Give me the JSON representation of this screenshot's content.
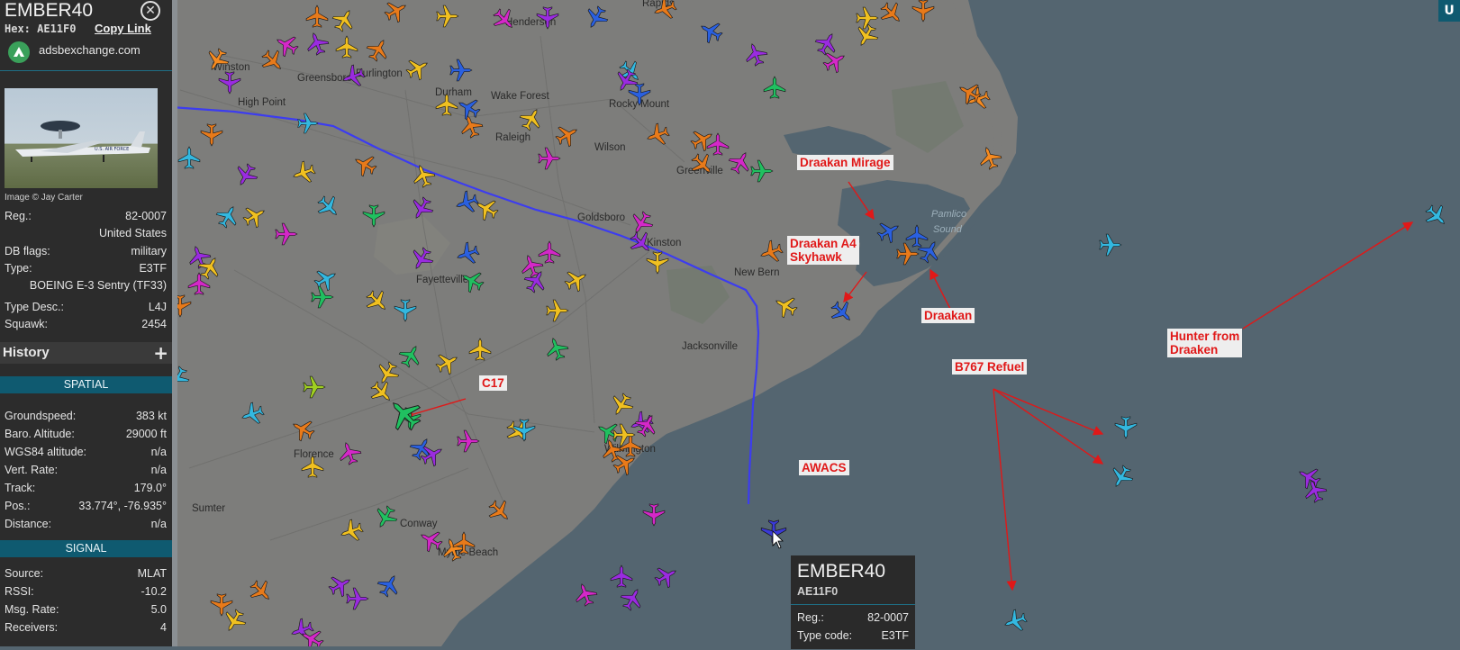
{
  "aircraft": {
    "callsign": "EMBER40",
    "hex_label": "Hex: AE11F0",
    "copy_link": "Copy Link",
    "source_site": "adsbexchange.com",
    "photo_credit": "Image © Jay Carter",
    "photo_livery": "U.S. AIR FORCE",
    "details": [
      {
        "key": "Reg.:",
        "value": "82-0007"
      },
      {
        "key": "",
        "value": "United States"
      },
      {
        "key": "DB flags:",
        "value": "military"
      },
      {
        "key": "Type:",
        "value": "E3TF"
      },
      {
        "key": "",
        "value": "BOEING E-3 Sentry (TF33)"
      },
      {
        "key": "Type Desc.:",
        "value": "L4J"
      },
      {
        "key": "Squawk:",
        "value": "2454"
      }
    ]
  },
  "history": {
    "title": "History",
    "add_icon": "plus-icon"
  },
  "spatial": {
    "title": "SPATIAL",
    "rows": [
      {
        "key": "Groundspeed:",
        "value": "383 kt"
      },
      {
        "key": "Baro. Altitude:",
        "value": "29000 ft"
      },
      {
        "key": "WGS84 altitude:",
        "value": "n/a"
      },
      {
        "key": "Vert. Rate:",
        "value": "n/a"
      },
      {
        "key": "Track:",
        "value": "179.0°"
      },
      {
        "key": "Pos.:",
        "value": "33.774°, -76.935°"
      },
      {
        "key": "Distance:",
        "value": "n/a"
      }
    ]
  },
  "signal": {
    "title": "SIGNAL",
    "rows": [
      {
        "key": "Source:",
        "value": "MLAT"
      },
      {
        "key": "RSSI:",
        "value": "-10.2"
      },
      {
        "key": "Msg. Rate:",
        "value": "5.0"
      },
      {
        "key": "Receivers:",
        "value": "4"
      }
    ]
  },
  "map": {
    "corner_button": "U",
    "places": [
      "Winston",
      "Greensboro",
      "Burlington",
      "Durham",
      "Wake Forest",
      "Raleigh",
      "Rocky Mount",
      "Wilson",
      "Greenville",
      "Goldsboro",
      "Kinston",
      "New Bern",
      "Jacksonville",
      "Fayetteville",
      "High Point",
      "Florence",
      "Wilmington",
      "Conway",
      "Myrtle Beach",
      "Sumter",
      "Pamlico",
      "Sound",
      "Rapids",
      "Henderson"
    ],
    "annotations": [
      {
        "id": "draakan-mirage",
        "text": "Draakan Mirage"
      },
      {
        "id": "draakan-a4",
        "text": "Draakan A4\nSkyhawk"
      },
      {
        "id": "draakan",
        "text": "Draakan"
      },
      {
        "id": "hunter",
        "text": "Hunter from\nDraaken"
      },
      {
        "id": "b767",
        "text": "B767 Refuel"
      },
      {
        "id": "c17",
        "text": "C17"
      },
      {
        "id": "awacs",
        "text": "AWACS"
      }
    ],
    "colors": {
      "water": "#546570",
      "land": "#7d7d7b",
      "track": "#3c3cf0",
      "arrow": "#e01818",
      "selected": "#3a3ad8"
    }
  },
  "tooltip": {
    "callsign": "EMBER40",
    "hex": "AE11F0",
    "rows": [
      {
        "key": "Reg.:",
        "value": "82-0007"
      },
      {
        "key": "Type code:",
        "value": "E3TF"
      }
    ]
  }
}
